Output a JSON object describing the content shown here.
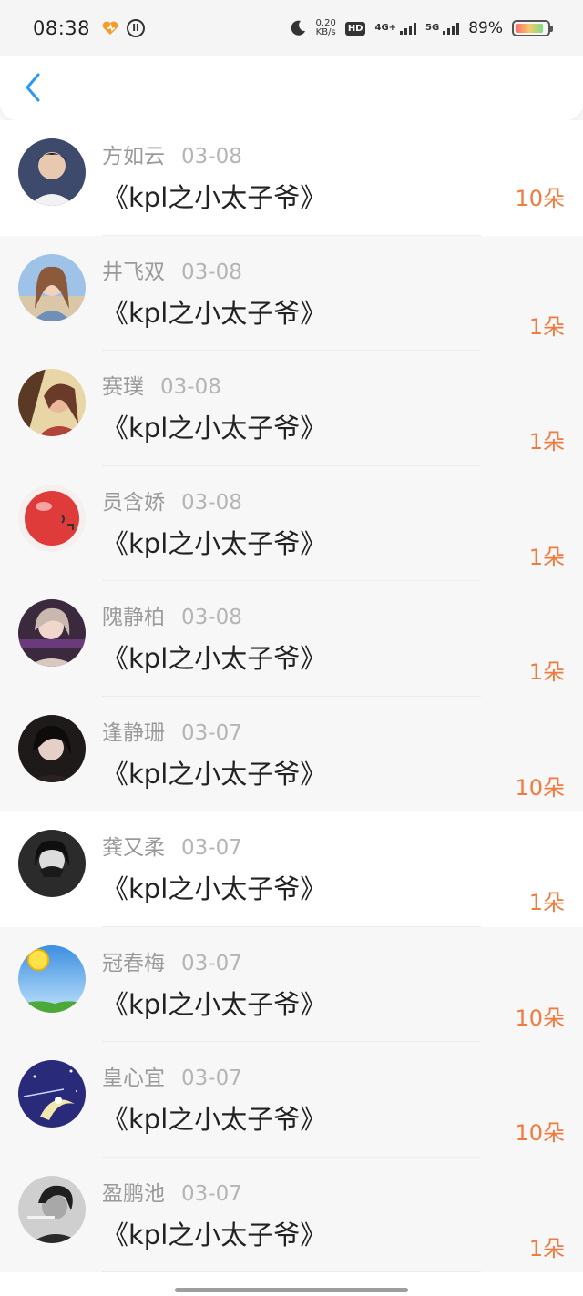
{
  "status_bar": {
    "time": "08:38",
    "speed_value": "0.20",
    "speed_unit": "KB/s",
    "hd_label": "HD",
    "net1_label": "4G+",
    "net2_label": "5G",
    "battery_percent": "89%",
    "battery_level": 0.89,
    "icons": [
      "heart-icon",
      "notification-circle-icon",
      "moon-icon",
      "signal-icon",
      "battery-icon"
    ]
  },
  "header": {
    "back_icon": "chevron-left-icon",
    "accent": "#2b9af3"
  },
  "amount_color": "#f07b3f",
  "rows": [
    {
      "name": "方如云",
      "date": "03-08",
      "title": "《kpl之小太子爷》",
      "amount": "10朵"
    },
    {
      "name": "井飞双",
      "date": "03-08",
      "title": "《kpl之小太子爷》",
      "amount": "1朵"
    },
    {
      "name": "赛璞",
      "date": "03-08",
      "title": "《kpl之小太子爷》",
      "amount": "1朵"
    },
    {
      "name": "员含娇",
      "date": "03-08",
      "title": "《kpl之小太子爷》",
      "amount": "1朵"
    },
    {
      "name": "隗静柏",
      "date": "03-08",
      "title": "《kpl之小太子爷》",
      "amount": "1朵"
    },
    {
      "name": "逢静珊",
      "date": "03-07",
      "title": "《kpl之小太子爷》",
      "amount": "10朵"
    },
    {
      "name": "龚又柔",
      "date": "03-07",
      "title": "《kpl之小太子爷》",
      "amount": "1朵"
    },
    {
      "name": "冠春梅",
      "date": "03-07",
      "title": "《kpl之小太子爷》",
      "amount": "10朵"
    },
    {
      "name": "皇心宜",
      "date": "03-07",
      "title": "《kpl之小太子爷》",
      "amount": "10朵"
    },
    {
      "name": "盈鹏池",
      "date": "03-07",
      "title": "《kpl之小太子爷》",
      "amount": "1朵"
    }
  ]
}
